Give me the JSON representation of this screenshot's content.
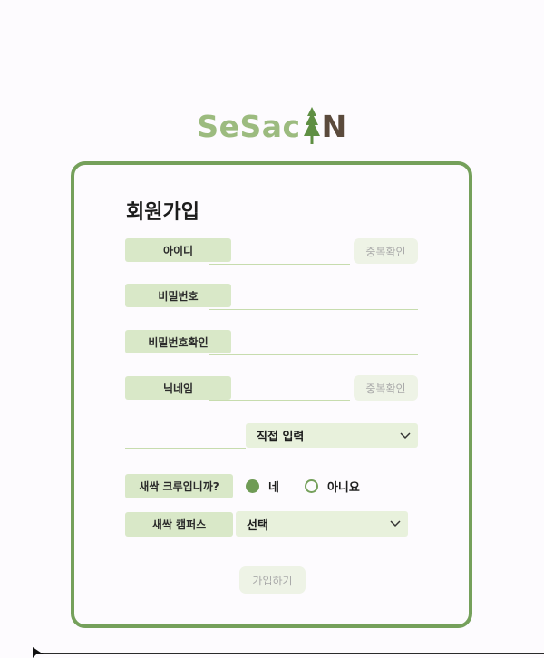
{
  "logo": {
    "part1": "SeSac",
    "part2": "N"
  },
  "form": {
    "title": "회원가입",
    "id_label": "아이디",
    "id_value": "",
    "id_check_button": "중복확인",
    "password_label": "비밀번호",
    "password_value": "",
    "password_confirm_label": "비밀번호확인",
    "password_confirm_value": "",
    "nickname_label": "닉네임",
    "nickname_value": "",
    "nickname_check_button": "중복확인",
    "email_value": "",
    "email_domain_select": "직접 입력",
    "crew_label": "새싹 크루입니까?",
    "crew_yes": "네",
    "crew_no": "아니요",
    "crew_selected": "네",
    "campus_label": "새싹 캠퍼스",
    "campus_select": "선택",
    "submit_button": "가입하기"
  },
  "colors": {
    "accent": "#75a05b",
    "label_bg": "#d9e8c8",
    "select_bg": "#e8f1dc",
    "button_bg": "#eef3e6",
    "logo_green": "#9cbb7f",
    "logo_brown": "#5b4a3c"
  },
  "icons": {
    "logo": "pine-tree-icon",
    "select_arrow": "chevron-down-icon",
    "cursor": "mouse-pointer-icon"
  }
}
